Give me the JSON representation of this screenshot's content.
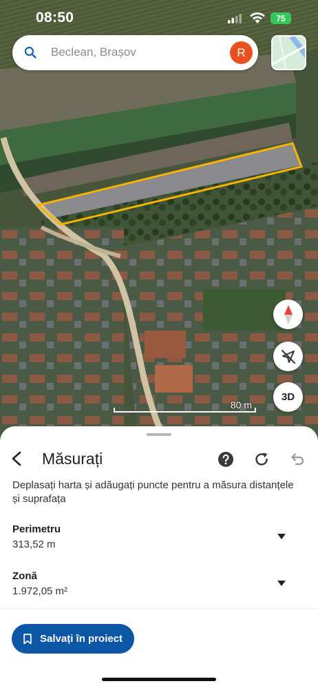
{
  "status_bar": {
    "time": "08:50",
    "battery": "75",
    "icons": [
      "signal-icon",
      "wifi-icon",
      "battery-icon"
    ]
  },
  "search": {
    "placeholder": "Beclean, Brașov",
    "avatar_letter": "R",
    "avatar_color": "#e8501f"
  },
  "map": {
    "scale_label": "80 m",
    "compass_icon": "compass-icon",
    "location_icon": "location-off-icon",
    "view_3d_label": "3D",
    "polygon_color": "#f5b400"
  },
  "sheet": {
    "title": "Măsurați",
    "description": "Deplasați harta și adăugați puncte pentru a măsura distanțele și suprafața",
    "header_icons": [
      "back-icon",
      "help-icon",
      "redo-icon",
      "undo-icon"
    ],
    "perimeter": {
      "label": "Perimetru",
      "value": "313,52 m"
    },
    "area": {
      "label": "Zonă",
      "value": "1.972,05 m²"
    },
    "save_button": "Salvați în proiect",
    "save_button_color": "#0b57a6"
  }
}
